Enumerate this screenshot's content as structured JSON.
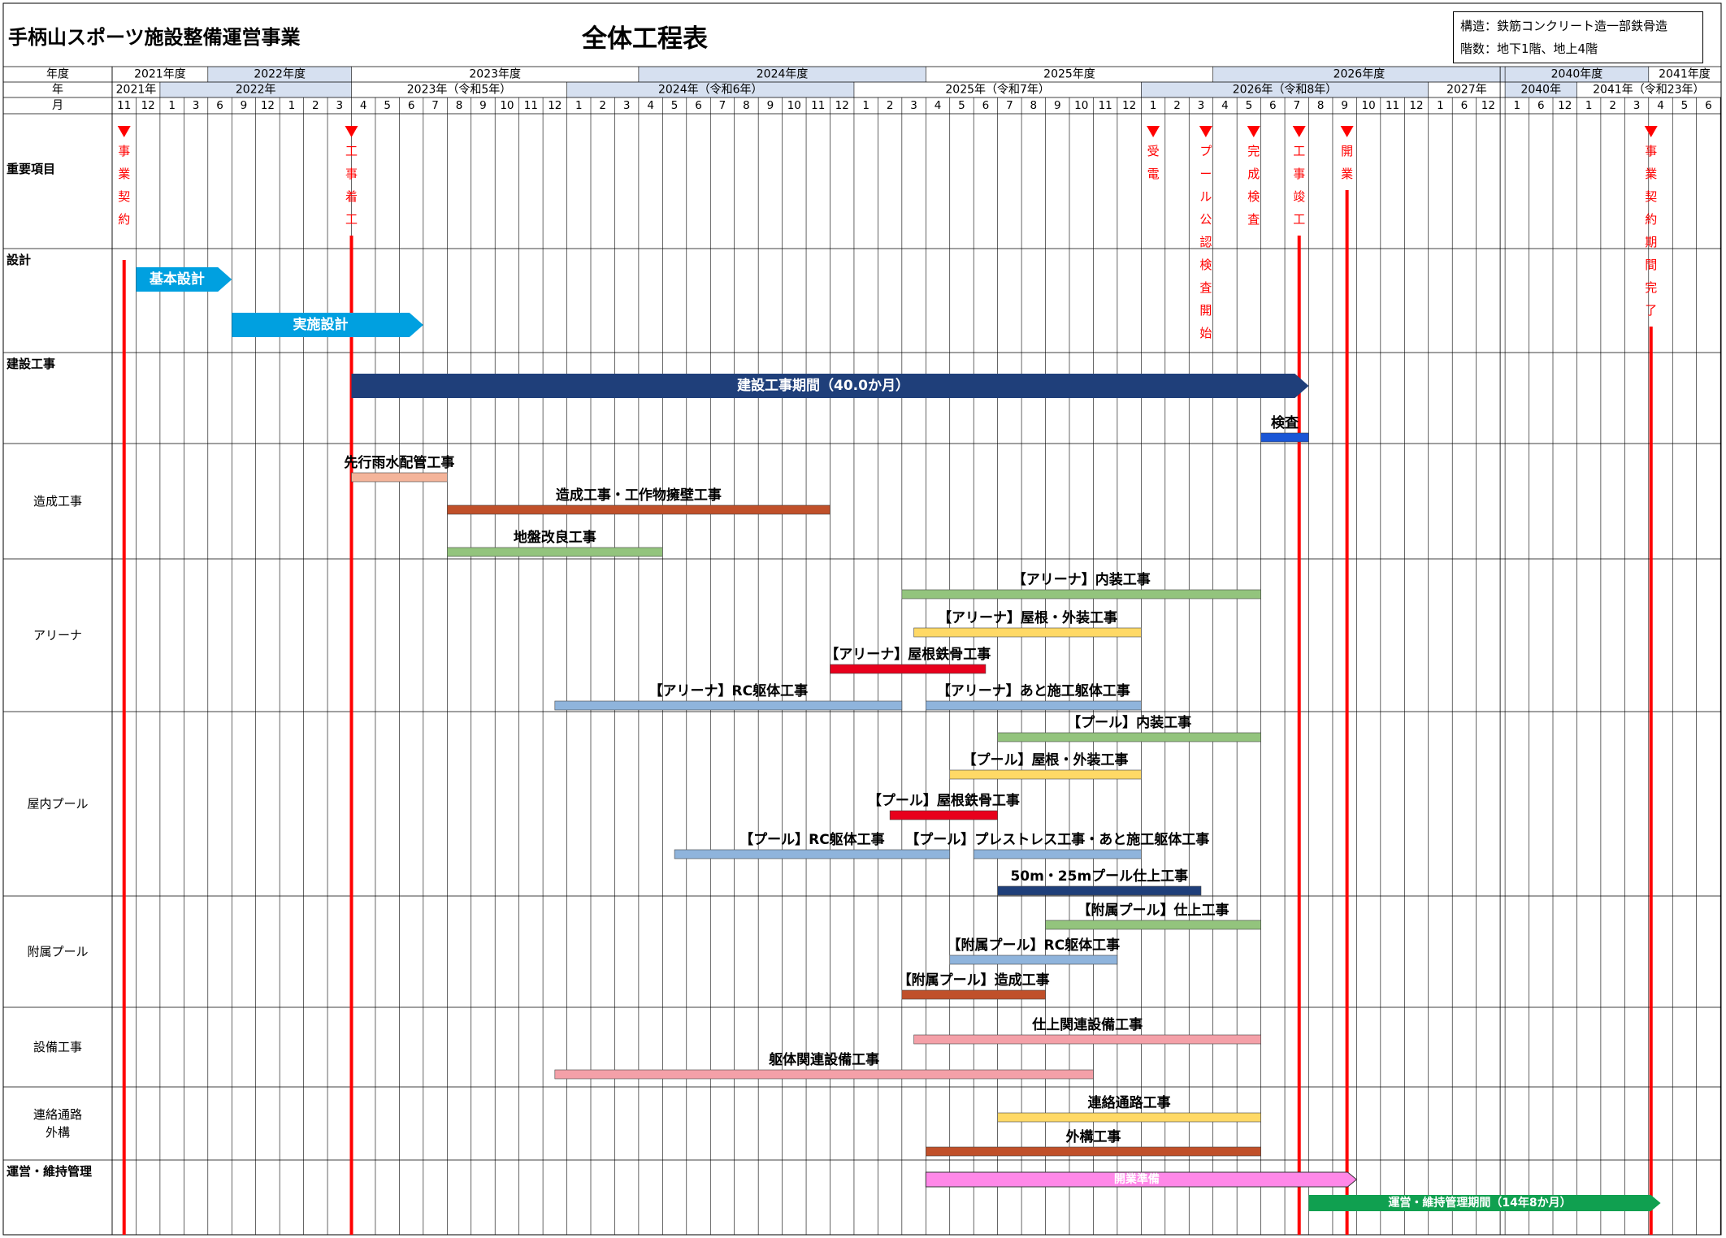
{
  "header": {
    "project_title": "手柄山スポーツ施設整備運営事業",
    "main_title": "全体工程表",
    "structure": "構造：鉄筋コンクリート造一部鉄骨造",
    "floors": "階数：地下1階、地上4階"
  },
  "chart_data": {
    "type": "gantt",
    "row_labels": {
      "fiscal": "年度",
      "year": "年",
      "month": "月"
    },
    "months": [
      "11",
      "12",
      "1",
      "3",
      "6",
      "9",
      "12",
      "1",
      "2",
      "3",
      "4",
      "5",
      "6",
      "7",
      "8",
      "9",
      "10",
      "11",
      "12",
      "1",
      "2",
      "3",
      "4",
      "5",
      "6",
      "7",
      "8",
      "9",
      "10",
      "11",
      "12",
      "1",
      "2",
      "3",
      "4",
      "5",
      "6",
      "7",
      "8",
      "9",
      "10",
      "11",
      "12",
      "1",
      "2",
      "3",
      "4",
      "5",
      "6",
      "7",
      "8",
      "9",
      "10",
      "11",
      "12",
      "1",
      "6",
      "12",
      "1",
      "6",
      "12",
      "1",
      "2",
      "3",
      "4",
      "5",
      "6"
    ],
    "fiscal_years": [
      {
        "label": "2021年度",
        "start": 0,
        "end": 4,
        "shaded": false
      },
      {
        "label": "2022年度",
        "start": 4,
        "end": 10,
        "shaded": true
      },
      {
        "label": "2023年度",
        "start": 10,
        "end": 22,
        "shaded": false
      },
      {
        "label": "2024年度",
        "start": 22,
        "end": 34,
        "shaded": true
      },
      {
        "label": "2025年度",
        "start": 34,
        "end": 46,
        "shaded": false
      },
      {
        "label": "2026年度",
        "start": 46,
        "end": 58,
        "shaded": true
      },
      {
        "label": "2040年度",
        "start": 58,
        "end": 64,
        "shaded": true
      },
      {
        "label": "2041年度",
        "start": 64,
        "end": 67,
        "shaded": false
      }
    ],
    "years": [
      {
        "label": "2021年",
        "start": 0,
        "end": 2,
        "shaded": false
      },
      {
        "label": "2022年",
        "start": 2,
        "end": 10,
        "shaded": true
      },
      {
        "label": "2023年（令和5年）",
        "start": 10,
        "end": 19,
        "shaded": false
      },
      {
        "label": "2024年（令和6年）",
        "start": 19,
        "end": 31,
        "shaded": true
      },
      {
        "label": "2025年（令和7年）",
        "start": 31,
        "end": 43,
        "shaded": false
      },
      {
        "label": "2026年（令和8年）",
        "start": 43,
        "end": 55,
        "shaded": true
      },
      {
        "label": "2027年",
        "start": 55,
        "end": 58,
        "shaded": false
      },
      {
        "label": "2040年",
        "start": 58,
        "end": 61,
        "shaded": true
      },
      {
        "label": "2041年（令和23年）",
        "start": 61,
        "end": 67,
        "shaded": false
      }
    ],
    "sections": [
      {
        "label": "重要項目",
        "bold": true,
        "align": "left"
      },
      {
        "label": "設計",
        "bold": true,
        "align": "left-top"
      },
      {
        "label": "建設工事",
        "bold": true,
        "align": "left-top"
      },
      {
        "label": "造成工事",
        "bold": false,
        "align": "center"
      },
      {
        "label": "アリーナ",
        "bold": false,
        "align": "center"
      },
      {
        "label": "屋内プール",
        "bold": false,
        "align": "center"
      },
      {
        "label": "附属プール",
        "bold": false,
        "align": "center"
      },
      {
        "label": "設備工事",
        "bold": false,
        "align": "center"
      },
      {
        "label": "連絡通路",
        "label2": "外構",
        "bold": false,
        "align": "center"
      },
      {
        "label": "運営・維持管理",
        "bold": true,
        "align": "left-top"
      }
    ],
    "milestones": [
      {
        "label": "事業契約",
        "at": 0.5
      },
      {
        "label": "工事着工",
        "at": 10
      },
      {
        "label": "受電",
        "at": 43.5
      },
      {
        "label": "プール公認検査開始",
        "at": 45.7
      },
      {
        "label": "完成検査",
        "at": 47.7
      },
      {
        "label": "工事竣工",
        "at": 49.6
      },
      {
        "label": "開業",
        "at": 51.6
      },
      {
        "label": "事業契約期間完了",
        "at": 64.1
      }
    ],
    "bars": [
      {
        "label": "基本設計",
        "start": 1,
        "end": 5,
        "color": "#00a0e0",
        "shape": "arrow",
        "text_in_bar": true,
        "text_color": "#ffffff",
        "lane": 1
      },
      {
        "label": "実施設計",
        "start": 5,
        "end": 13,
        "color": "#00a0e0",
        "shape": "arrow",
        "text_in_bar": true,
        "text_color": "#ffffff",
        "lane": 2
      },
      {
        "label": "建設工事期間（40.0か月）",
        "start": 10,
        "end": 50,
        "color": "#1f3f7a",
        "shape": "arrow",
        "text_in_bar": true,
        "text_color": "#ffffff",
        "lane": 3
      },
      {
        "label": "検査",
        "start": 48,
        "end": 50,
        "color": "#1a56d6",
        "shape": "bar",
        "lane": 4
      },
      {
        "label": "先行雨水配管工事",
        "start": 10,
        "end": 14,
        "color": "#f4b49a",
        "shape": "bar",
        "lane": 5
      },
      {
        "label": "造成工事・工作物擁壁工事",
        "start": 14,
        "end": 30,
        "color": "#c0502a",
        "shape": "bar",
        "lane": 6
      },
      {
        "label": "地盤改良工事",
        "start": 14,
        "end": 23,
        "color": "#93c47d",
        "shape": "bar",
        "lane": 7
      },
      {
        "label": "【アリーナ】内装工事",
        "start": 33,
        "end": 48,
        "color": "#93c47d",
        "shape": "bar",
        "lane": 8
      },
      {
        "label": "【アリーナ】屋根・外装工事",
        "start": 33.5,
        "end": 43,
        "color": "#ffd966",
        "shape": "bar",
        "lane": 9
      },
      {
        "label": "【アリーナ】屋根鉄骨工事",
        "start": 30,
        "end": 36.5,
        "color": "#e8001c",
        "shape": "bar",
        "lane": 10
      },
      {
        "label": "【アリーナ】RC躯体工事",
        "start": 18.5,
        "end": 33,
        "color": "#8fb4dc",
        "shape": "bar",
        "lane": 11
      },
      {
        "label": "【アリーナ】あと施工躯体工事",
        "start": 34,
        "end": 43,
        "color": "#8fb4dc",
        "shape": "bar",
        "lane": 11
      },
      {
        "label": "【プール】内装工事",
        "start": 37,
        "end": 48,
        "color": "#93c47d",
        "shape": "bar",
        "lane": 12
      },
      {
        "label": "【プール】屋根・外装工事",
        "start": 35,
        "end": 43,
        "color": "#ffd966",
        "shape": "bar",
        "lane": 13
      },
      {
        "label": "【プール】屋根鉄骨工事",
        "start": 32.5,
        "end": 37,
        "color": "#e8001c",
        "shape": "bar",
        "lane": 14
      },
      {
        "label": "【プール】RC躯体工事",
        "start": 23.5,
        "end": 35,
        "color": "#8fb4dc",
        "shape": "bar",
        "lane": 15
      },
      {
        "label": "【プール】プレストレス工事・あと施工躯体工事",
        "start": 36,
        "end": 43,
        "color": "#8fb4dc",
        "shape": "bar",
        "lane": 15
      },
      {
        "label": "50m・25mプール仕上工事",
        "start": 37,
        "end": 45.5,
        "color": "#1f3f7a",
        "shape": "bar",
        "lane": 16
      },
      {
        "label": "【附属プール】仕上工事",
        "start": 39,
        "end": 48,
        "color": "#93c47d",
        "shape": "bar",
        "lane": 17
      },
      {
        "label": "【附属プール】RC躯体工事",
        "start": 35,
        "end": 42,
        "color": "#8fb4dc",
        "shape": "bar",
        "lane": 18
      },
      {
        "label": "【附属プール】造成工事",
        "start": 33,
        "end": 39,
        "color": "#c0502a",
        "shape": "bar",
        "lane": 19
      },
      {
        "label": "仕上関連設備工事",
        "start": 33.5,
        "end": 48,
        "color": "#f4a0a8",
        "shape": "bar",
        "lane": 20
      },
      {
        "label": "躯体関連設備工事",
        "start": 18.5,
        "end": 41,
        "color": "#f4a0a8",
        "shape": "bar",
        "lane": 21
      },
      {
        "label": "連絡通路工事",
        "start": 37,
        "end": 48,
        "color": "#ffd966",
        "shape": "bar",
        "lane": 22
      },
      {
        "label": "外構工事",
        "start": 34,
        "end": 48,
        "color": "#c0502a",
        "shape": "bar",
        "lane": 23
      },
      {
        "label": "開業準備",
        "start": 34,
        "end": 52,
        "color": "#ff88e8",
        "shape": "arrow",
        "text_in_bar": true,
        "text_color": "#ffffff",
        "lane": 24
      },
      {
        "label": "運営・維持管理期間（14年8か月）",
        "start": 50,
        "end": 64.5,
        "color": "#10a050",
        "shape": "arrow",
        "text_in_bar": true,
        "text_color": "#ffffff",
        "lane": 25
      }
    ]
  }
}
